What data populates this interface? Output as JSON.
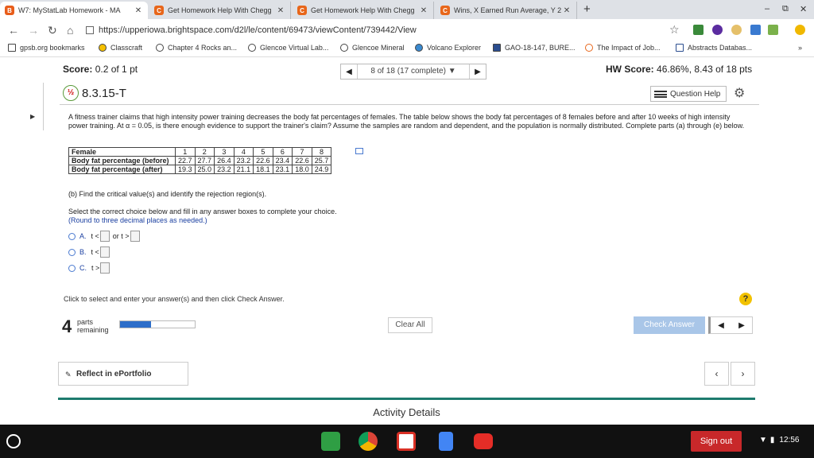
{
  "browser": {
    "tabs": [
      {
        "title": "W7: MyStatLab Homework - MA",
        "favicon": "B",
        "fav_color": "#e85d1a",
        "active": true
      },
      {
        "title": "Get Homework Help With Chegg",
        "favicon": "C",
        "fav_color": "#e8661a",
        "active": false
      },
      {
        "title": "Get Homework Help With Chegg",
        "favicon": "C",
        "fav_color": "#e8661a",
        "active": false
      },
      {
        "title": "Wins, X Earned Run Average, Y 2",
        "favicon": "C",
        "fav_color": "#e8661a",
        "active": false
      }
    ],
    "new_tab": "+",
    "url": "https://upperiowa.brightspace.com/d2l/le/content/69473/viewContent/739442/View"
  },
  "bookmarks": [
    {
      "label": "gpsb.org bookmarks"
    },
    {
      "label": "Classcraft"
    },
    {
      "label": "Chapter 4 Rocks an..."
    },
    {
      "label": "Glencoe Virtual Lab..."
    },
    {
      "label": "Glencoe Mineral"
    },
    {
      "label": "Volcano Explorer"
    },
    {
      "label": "GAO-18-147, BURE..."
    },
    {
      "label": "The Impact of Job..."
    },
    {
      "label": "Abstracts Databas..."
    }
  ],
  "bookmarks_more": "»",
  "score": {
    "label": "Score:",
    "value": "0.2 of 1 pt"
  },
  "question_nav": {
    "prev": "◀",
    "position": "8 of 18 (17 complete)",
    "caret": "▼",
    "next": "▶"
  },
  "hw_score": {
    "label": "HW Score:",
    "value": "46.86%, 8.43 of 18 pts"
  },
  "question": {
    "id": "8.3.15-T",
    "help_label": "Question Help",
    "prompt": "A fitness trainer claims that high intensity power training decreases the body fat percentages of females. The table below shows the body fat percentages of 8 females before and after 10 weeks of high intensity power training. At α = 0.05, is there enough evidence to support the trainer's claim? Assume the samples are random and dependent, and the population is normally distributed. Complete parts (a) through (e) below.",
    "table": {
      "header_label": "Female",
      "columns": [
        "1",
        "2",
        "3",
        "4",
        "5",
        "6",
        "7",
        "8"
      ],
      "rows": [
        {
          "label": "Body fat percentage (before)",
          "values": [
            "22.7",
            "27.7",
            "26.4",
            "23.2",
            "22.6",
            "23.4",
            "22.6",
            "25.7"
          ]
        },
        {
          "label": "Body fat percentage (after)",
          "values": [
            "19.3",
            "25.0",
            "23.2",
            "21.1",
            "18.1",
            "23.1",
            "18.0",
            "24.9"
          ]
        }
      ]
    },
    "part": "(b) Find the critical value(s) and identify the rejection region(s).",
    "select_instruction": "Select the correct choice below and fill in any answer boxes to complete your choice.",
    "round_note": "(Round to three decimal places as needed.)",
    "choices": [
      {
        "letter": "A.",
        "pre": "t <",
        "mid": "or t >"
      },
      {
        "letter": "B.",
        "pre": "t <",
        "mid": ""
      },
      {
        "letter": "C.",
        "pre": "t >",
        "mid": ""
      }
    ]
  },
  "footer": {
    "instruction": "Click to select and enter your answer(s) and then click Check Answer.",
    "help_icon": "?",
    "parts_count": "4",
    "parts_label_1": "parts",
    "parts_label_2": "remaining",
    "progress_fraction": 0.42,
    "clear_all": "Clear All",
    "check_answer": "Check Answer",
    "prev_arrow": "◀",
    "next_arrow": "▶"
  },
  "portfolio": {
    "reflect_label": "Reflect in ePortfolio",
    "prev": "‹",
    "next": "›"
  },
  "activity_details": "Activity Details",
  "taskbar": {
    "sign_out": "Sign out",
    "time": "12:56"
  }
}
